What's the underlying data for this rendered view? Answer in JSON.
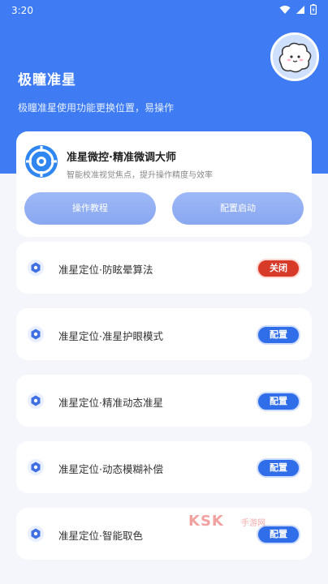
{
  "status_bar": {
    "time": "3:20"
  },
  "header": {
    "title": "极瞳准星",
    "subtitle": "极瞳准星使用功能更换位置，易操作"
  },
  "top_card": {
    "title": "准星微控·精准微调大师",
    "subtitle": "智能校准视觉焦点，提升操作精度与效率",
    "tutorial_label": "操作教程",
    "start_label": "配置启动"
  },
  "items": [
    {
      "label": "准星定位·防眩晕算法",
      "action": "关闭"
    },
    {
      "label": "准星定位·准星护眼模式",
      "action": "配置"
    },
    {
      "label": "准星定位·精准动态准星",
      "action": "配置"
    },
    {
      "label": "准星定位·动态模糊补偿",
      "action": "配置"
    },
    {
      "label": "准星定位·智能取色",
      "action": "配置"
    }
  ],
  "watermark": {
    "logo": "KSK",
    "text": "手游网"
  },
  "colors": {
    "primary": "#3f7cf4",
    "config_button": "#2f6ee8",
    "off_button": "#d83a2a"
  }
}
